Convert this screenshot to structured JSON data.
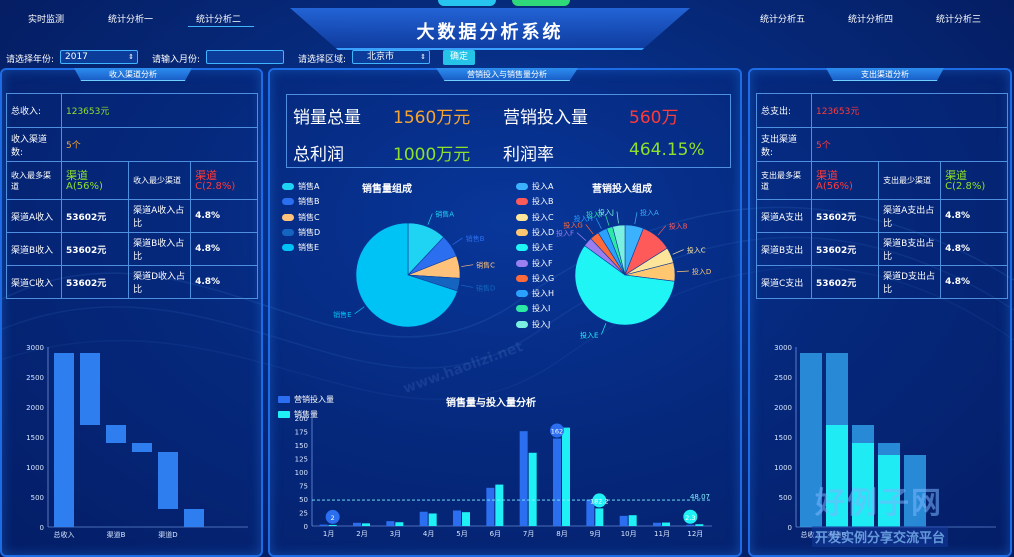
{
  "header": {
    "title": "大数据分析系统",
    "tabs_left": [
      "实时监测",
      "统计分析一",
      "统计分析二"
    ],
    "tabs_right": [
      "统计分析五",
      "统计分析四",
      "统计分析三"
    ]
  },
  "filters": {
    "year_label": "请选择年份:",
    "year_value": "2017",
    "month_label": "请输入月份:",
    "month_value": "",
    "region_label": "请选择区域:",
    "region_value": "北京市",
    "confirm_label": "确定"
  },
  "left_panel": {
    "title": "收入渠道分析",
    "total_label": "总收入:",
    "total_value": "123653元",
    "channel_count_label": "收入渠道数:",
    "channel_count_value": "5个",
    "most_label": "收入最多渠道",
    "most_value_a": "渠道",
    "most_value_b": "A(56%)",
    "least_label": "收入最少渠道",
    "least_value_a": "渠道",
    "least_value_b": "C(2.8%)",
    "rows": [
      {
        "k1": "渠道A收入",
        "v1": "53602元",
        "k2": "渠道A收入占比",
        "v2": "4.8%"
      },
      {
        "k1": "渠道B收入",
        "v1": "53602元",
        "k2": "渠道B收入占比",
        "v2": "4.8%"
      },
      {
        "k1": "渠道C收入",
        "v1": "53602元",
        "k2": "渠道D收入占比",
        "v2": "4.8%"
      }
    ]
  },
  "right_panel": {
    "title": "支出渠道分析",
    "total_label": "总支出:",
    "total_value": "123653元",
    "channel_count_label": "支出渠道数:",
    "channel_count_value": "5个",
    "most_label": "支出最多渠道",
    "most_value_a": "渠道",
    "most_value_b": "A(56%)",
    "least_label": "支出最少渠道",
    "least_value_a": "渠道",
    "least_value_b": "C(2.8%)",
    "rows": [
      {
        "k1": "渠道A支出",
        "v1": "53602元",
        "k2": "渠道A支出占比",
        "v2": "4.8%"
      },
      {
        "k1": "渠道B支出",
        "v1": "53602元",
        "k2": "渠道B支出占比",
        "v2": "4.8%"
      },
      {
        "k1": "渠道C支出",
        "v1": "53602元",
        "k2": "渠道D支出占比",
        "v2": "4.8%"
      }
    ]
  },
  "center_panel": {
    "title": "营销投入与销售量分析",
    "kpis": {
      "sales_total_label": "销量总量",
      "sales_total_value": "1560万元",
      "marketing_label": "营销投入量",
      "marketing_value": "560万",
      "profit_label": "总利润",
      "profit_value": "1000万元",
      "margin_label": "利润率",
      "margin_value": "464.15%"
    },
    "sales_pie_title": "销售量组成",
    "invest_pie_title": "营销投入组成",
    "combo_title": "销售量与投入量分析"
  },
  "watermark": {
    "brand": "好例子网",
    "slogan": "开发实例分享交流平台",
    "url": "www.haolizi.net"
  },
  "colors": {
    "panel_border": "#1e6be6",
    "cyan": "#22e6f5",
    "blue": "#2b6ef0",
    "green": "#8ee02b",
    "orange": "#f7a530",
    "red": "#ff3a3a"
  },
  "chart_data": [
    {
      "id": "income_waterfall",
      "type": "bar",
      "categories": [
        "总收入",
        "",
        "渠道B",
        "",
        "渠道D",
        ""
      ],
      "series": [
        {
          "low": [
            0,
            1700,
            1400,
            1250,
            300,
            0
          ],
          "high": [
            2900,
            2900,
            1700,
            1400,
            1250,
            300
          ]
        }
      ],
      "ylim": [
        0,
        3000
      ],
      "yticks": [
        0,
        500,
        1000,
        1500,
        2000,
        2500,
        3000
      ]
    },
    {
      "id": "expense_bars",
      "type": "bar",
      "categories": [
        "总收入",
        "渠道B",
        "",
        "",
        ""
      ],
      "series": [
        {
          "values": [
            2900,
            2900,
            1700,
            1400,
            1200
          ]
        },
        {
          "values": [
            0,
            1700,
            1400,
            1200,
            0
          ]
        }
      ],
      "ylim": [
        0,
        3000
      ],
      "yticks": [
        0,
        500,
        1000,
        1500,
        2000,
        2500,
        3000
      ]
    },
    {
      "id": "sales_pie",
      "type": "pie",
      "title": "销售量组成",
      "labels": [
        "销售A",
        "销售B",
        "销售C",
        "销售D",
        "销售E"
      ],
      "values": [
        12,
        7,
        7,
        4,
        70
      ],
      "colors": [
        "#1fd3f2",
        "#2b6ef0",
        "#ffc27a",
        "#1565c0",
        "#00c3f5"
      ]
    },
    {
      "id": "invest_pie",
      "type": "pie",
      "title": "营销投入组成",
      "labels": [
        "投入A",
        "投入B",
        "投入C",
        "投入D",
        "投入E",
        "投入F",
        "投入G",
        "投入H",
        "投入I",
        "投入J"
      ],
      "values": [
        6,
        10,
        5,
        6,
        58,
        3,
        3,
        3,
        2,
        4
      ],
      "colors": [
        "#3cb2ff",
        "#ff5a5a",
        "#ffe59a",
        "#ffc870",
        "#1ff5f5",
        "#9a7ff0",
        "#ff6a3a",
        "#2aa0ff",
        "#2ce8a5",
        "#7bf0e0"
      ]
    },
    {
      "id": "combo_bar",
      "type": "bar",
      "title": "销售量与投入量分析",
      "categories": [
        "1月",
        "2月",
        "3月",
        "4月",
        "5月",
        "6月",
        "7月",
        "8月",
        "9月",
        "10月",
        "11月",
        "12月"
      ],
      "series": [
        {
          "name": "营销投入量",
          "values": [
            2.6,
            5.9,
            9.0,
            26.4,
            28.7,
            70.7,
            175.6,
            162,
            48.7,
            18.8,
            6.0,
            2.3
          ]
        },
        {
          "name": "销售量",
          "values": [
            2.0,
            4.9,
            7.0,
            23.2,
            25.6,
            76.7,
            135.6,
            182.2,
            32.6,
            20.0,
            6.4,
            3.3
          ]
        }
      ],
      "avg_line": 48.07,
      "markers": [
        {
          "label": "2"
        },
        {
          "label": "162"
        },
        {
          "label": "182.2"
        },
        {
          "label": "2.3"
        }
      ],
      "ylim": [
        0,
        200
      ],
      "yticks": [
        0,
        25,
        50,
        75,
        100,
        125,
        150,
        175,
        200
      ]
    }
  ]
}
